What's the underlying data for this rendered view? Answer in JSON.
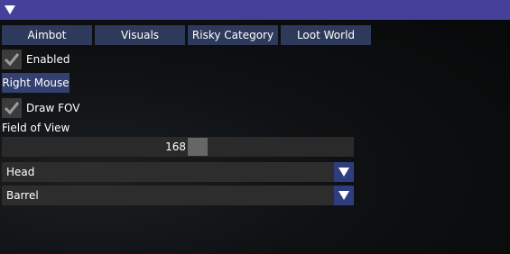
{
  "colors": {
    "titlebar": "#45419a",
    "tab_bg": "#2e3a5c",
    "key_button_bg": "#334070",
    "combo_arrow_bg": "#2e3d7e",
    "frame_bg": "#2d2d2d",
    "checkbox_bg": "#3b3b3b"
  },
  "tabs": [
    {
      "label": "Aimbot"
    },
    {
      "label": "Visuals"
    },
    {
      "label": "Risky Category"
    },
    {
      "label": "Loot World"
    }
  ],
  "aimbot": {
    "enabled": {
      "label": "Enabled",
      "checked": true,
      "icon": "checkmark-icon"
    },
    "key_button": {
      "label": "Right Mouse"
    },
    "draw_fov": {
      "label": "Draw FOV",
      "checked": true,
      "icon": "checkmark-icon"
    },
    "fov_slider": {
      "label": "Field of View",
      "value": "168"
    },
    "target_bone": {
      "value": "Head",
      "icon": "chevron-down-icon"
    },
    "weapon_part": {
      "value": "Barrel",
      "icon": "chevron-down-icon"
    }
  }
}
